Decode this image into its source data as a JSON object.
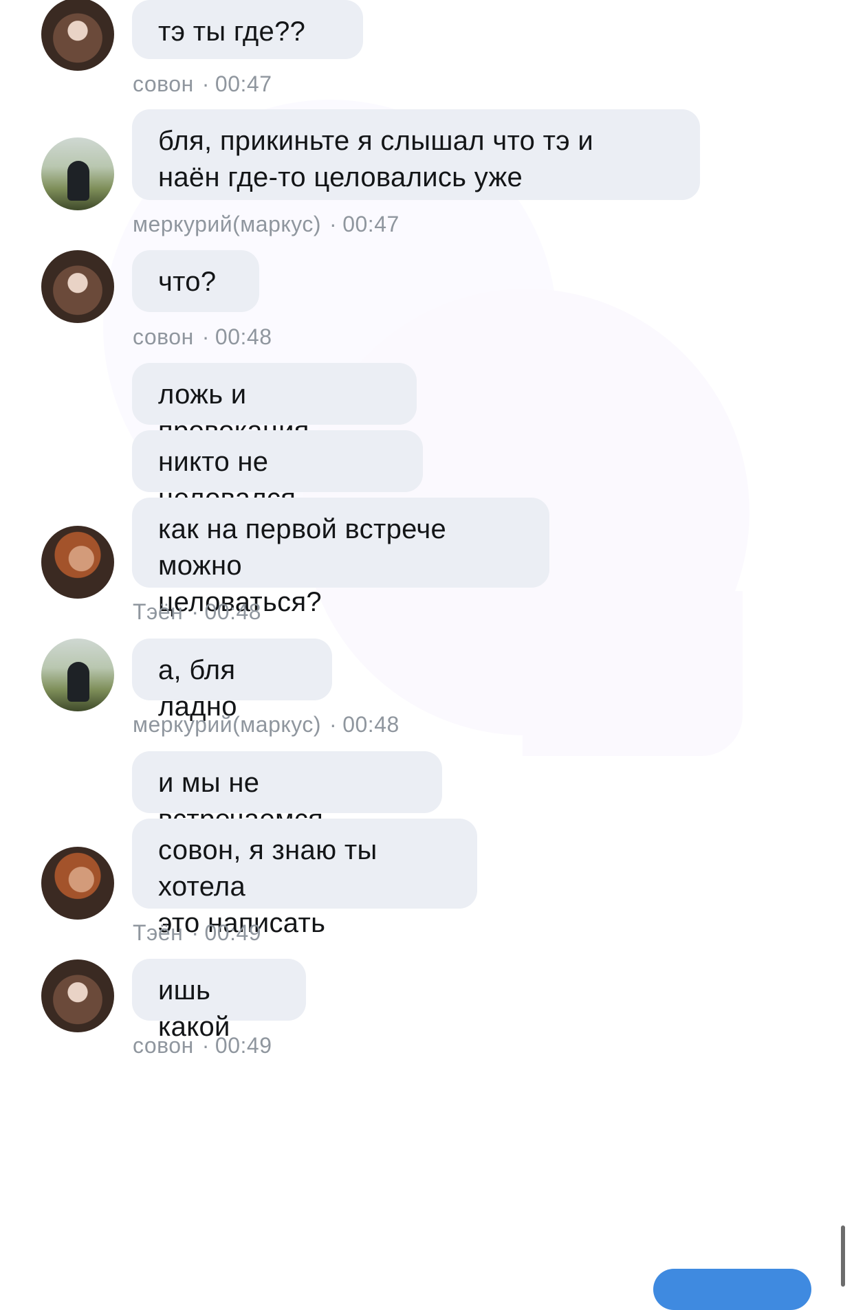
{
  "messages": [
    {
      "id": "m1",
      "author": "совон",
      "time": "00:47",
      "text": "тэ ты где??",
      "avatar": "avatar-sowon"
    },
    {
      "id": "m2",
      "author": "меркурий(маркус)",
      "time": "00:47",
      "text": "бля, прикиньте я слышал что тэ и\nнаён где-то целовались уже",
      "avatar": "avatar-markus"
    },
    {
      "id": "m3",
      "author": "совон",
      "time": "00:48",
      "text": "что?",
      "avatar": "avatar-sowon"
    },
    {
      "id": "m4a",
      "author": "Тэён",
      "time": "00:48",
      "text": "ложь и провокация",
      "avatar": "avatar-taeyong"
    },
    {
      "id": "m4b",
      "text": "никто не целовался"
    },
    {
      "id": "m4c",
      "text": "как на первой встрече можно\nцеловаться?"
    },
    {
      "id": "m5",
      "author": "меркурий(маркус)",
      "time": "00:48",
      "text": "а, бля ладно",
      "avatar": "avatar-markus"
    },
    {
      "id": "m6a",
      "author": "Тэён",
      "time": "00:49",
      "text": "и мы не встречаемся",
      "avatar": "avatar-taeyong"
    },
    {
      "id": "m6b",
      "text": "совон, я знаю ты хотела\nэто написать"
    },
    {
      "id": "m7",
      "author": "совон",
      "time": "00:49",
      "text": "ишь какой",
      "avatar": "avatar-sowon"
    }
  ],
  "meta_separator": "·",
  "colors": {
    "bubble": "#ebeef4",
    "meta": "#8f969e",
    "accent": "#3f8ae0"
  }
}
